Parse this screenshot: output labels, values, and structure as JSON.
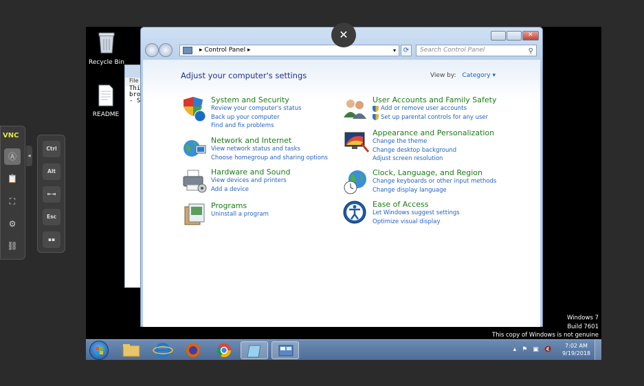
{
  "desktop": {
    "icons": [
      {
        "label": "Recycle Bin"
      },
      {
        "label": "README"
      }
    ],
    "watermark": [
      "Windows 7",
      "Build 7601",
      "This copy of Windows is not genuine"
    ]
  },
  "notepad": {
    "menu": "File",
    "lines": [
      "Thi",
      "bro",
      "",
      "- S"
    ]
  },
  "window": {
    "breadcrumb": "Control Panel",
    "search_placeholder": "Search Control Panel",
    "heading": "Adjust your computer's settings",
    "view_by_label": "View by:",
    "view_by_value": "Category",
    "categories": [
      {
        "title": "System and Security",
        "links": [
          "Review your computer's status",
          "Back up your computer",
          "Find and fix problems"
        ]
      },
      {
        "title": "Network and Internet",
        "links": [
          "View network status and tasks",
          "Choose homegroup and sharing options"
        ]
      },
      {
        "title": "Hardware and Sound",
        "links": [
          "View devices and printers",
          "Add a device"
        ]
      },
      {
        "title": "Programs",
        "links": [
          "Uninstall a program"
        ]
      },
      {
        "title": "User Accounts and Family Safety",
        "links": [
          "Add or remove user accounts",
          "Set up parental controls for any user"
        ]
      },
      {
        "title": "Appearance and Personalization",
        "links": [
          "Change the theme",
          "Change desktop background",
          "Adjust screen resolution"
        ]
      },
      {
        "title": "Clock, Language, and Region",
        "links": [
          "Change keyboards or other input methods",
          "Change display language"
        ]
      },
      {
        "title": "Ease of Access",
        "links": [
          "Let Windows suggest settings",
          "Optimize visual display"
        ]
      }
    ]
  },
  "vnc": {
    "logo": "VNC",
    "keys": [
      "Ctrl",
      "Alt",
      "Esc"
    ]
  },
  "overlay": {
    "close_glyph": "✕"
  },
  "taskbar": {
    "time": "7:02 AM",
    "date": "9/19/2018"
  },
  "colors": {
    "link": "#1f62c5",
    "category_title": "#187d14",
    "heading": "#1e3287"
  }
}
